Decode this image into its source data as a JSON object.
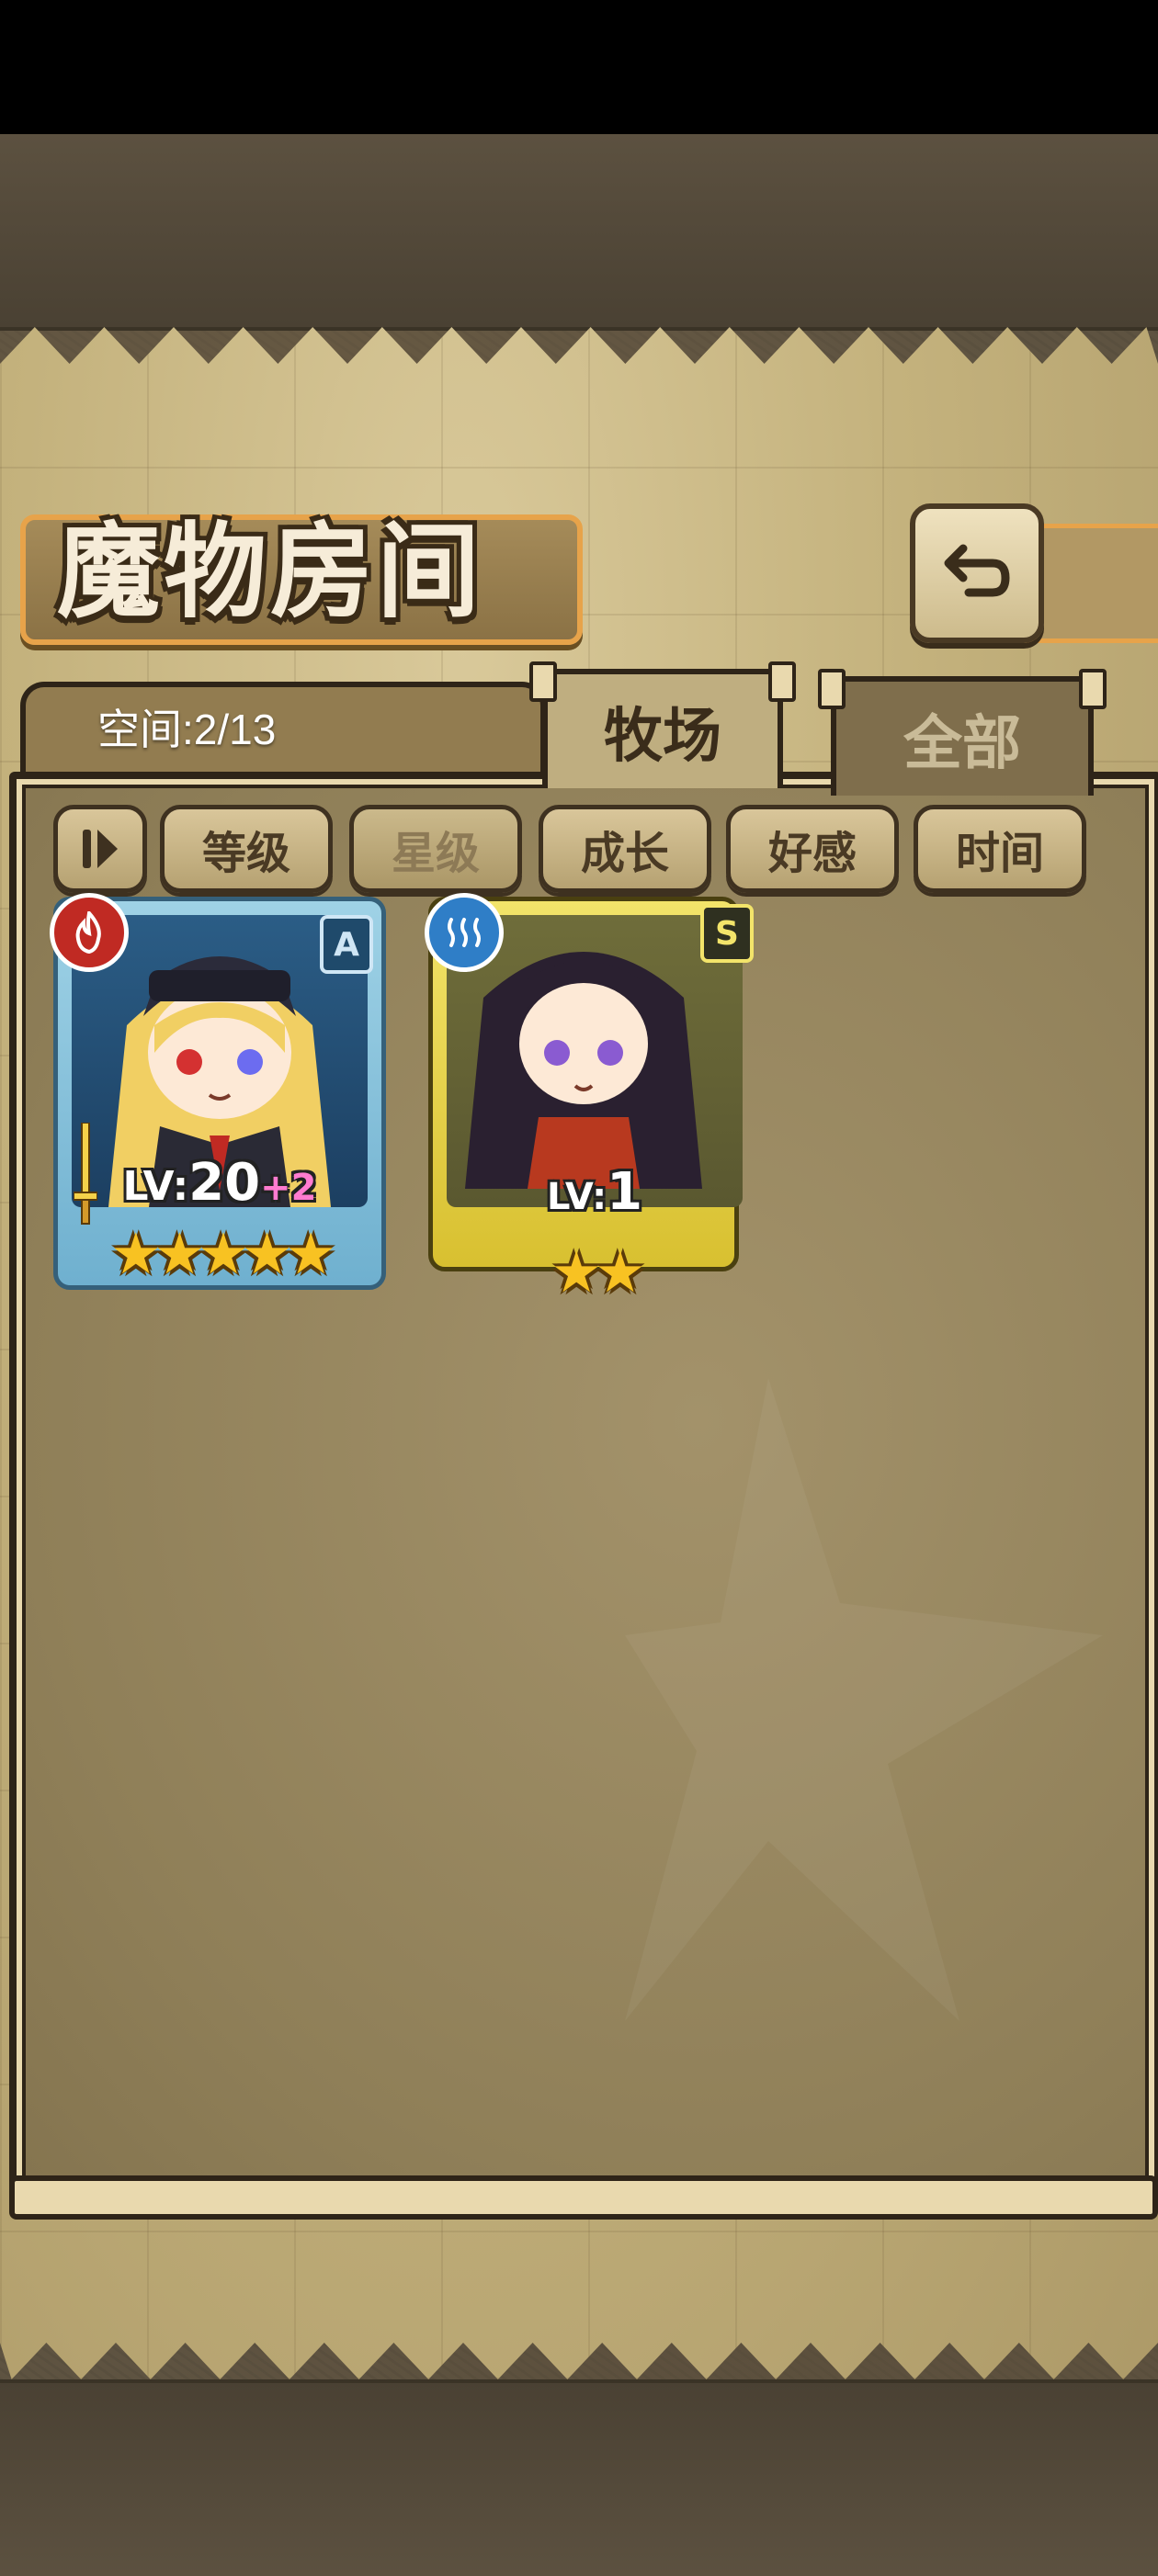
{
  "title": "魔物房间",
  "space": "空间:2/13",
  "tabs": [
    {
      "label": "牧场",
      "active": true
    },
    {
      "label": "全部",
      "active": false
    }
  ],
  "sort_buttons": [
    "等级",
    "星级",
    "成长",
    "好感",
    "时间"
  ],
  "selected_sort": "星级",
  "cards": [
    {
      "element": "fire",
      "rank": "A",
      "level_prefix": "LV:",
      "level": "20",
      "bonus": "+2",
      "stars": "★★★★★",
      "star_count": 5
    },
    {
      "element": "water",
      "rank": "S",
      "level_prefix": "LV:",
      "level": "1",
      "stars": "★★",
      "star_count": 2
    }
  ],
  "colors": {
    "panel": "#c4b27d",
    "frame": "#2e2418",
    "accent_orange": "#e7a34a",
    "card_a": "#9fd2e6",
    "card_s": "#f3e46a",
    "star": "#f8c222",
    "fire": "#c02a23",
    "water": "#2f7ec7"
  }
}
